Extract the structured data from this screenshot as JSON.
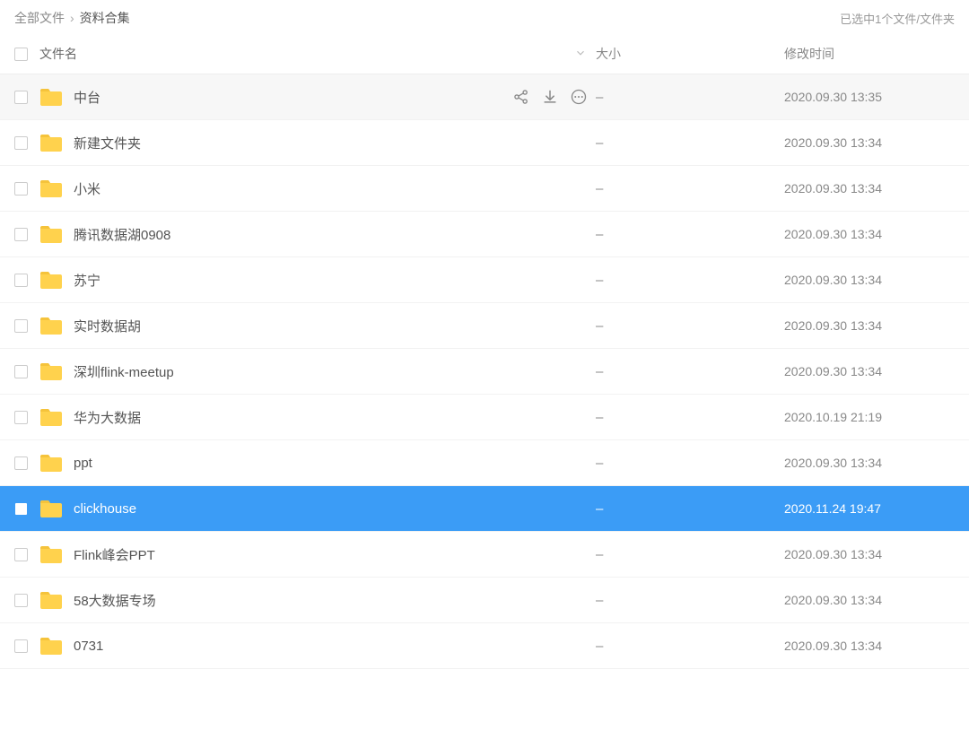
{
  "breadcrumb": {
    "root": "全部文件",
    "current": "资料合集"
  },
  "selection_status": "已选中1个文件/文件夹",
  "columns": {
    "name": "文件名",
    "size": "大小",
    "time": "修改时间"
  },
  "size_placeholder": "–",
  "files": [
    {
      "name": "中台",
      "size": "–",
      "time": "2020.09.30 13:35",
      "selected": false,
      "hovered": true
    },
    {
      "name": "新建文件夹",
      "size": "–",
      "time": "2020.09.30 13:34",
      "selected": false,
      "hovered": false
    },
    {
      "name": "小米",
      "size": "–",
      "time": "2020.09.30 13:34",
      "selected": false,
      "hovered": false
    },
    {
      "name": "腾讯数据湖0908",
      "size": "–",
      "time": "2020.09.30 13:34",
      "selected": false,
      "hovered": false
    },
    {
      "name": "苏宁",
      "size": "–",
      "time": "2020.09.30 13:34",
      "selected": false,
      "hovered": false
    },
    {
      "name": "实时数据胡",
      "size": "–",
      "time": "2020.09.30 13:34",
      "selected": false,
      "hovered": false
    },
    {
      "name": "深圳flink-meetup",
      "size": "–",
      "time": "2020.09.30 13:34",
      "selected": false,
      "hovered": false
    },
    {
      "name": "华为大数据",
      "size": "–",
      "time": "2020.10.19 21:19",
      "selected": false,
      "hovered": false
    },
    {
      "name": "ppt",
      "size": "–",
      "time": "2020.09.30 13:34",
      "selected": false,
      "hovered": false
    },
    {
      "name": "clickhouse",
      "size": "–",
      "time": "2020.11.24 19:47",
      "selected": true,
      "hovered": false
    },
    {
      "name": "Flink峰会PPT",
      "size": "–",
      "time": "2020.09.30 13:34",
      "selected": false,
      "hovered": false
    },
    {
      "name": "58大数据专场",
      "size": "–",
      "time": "2020.09.30 13:34",
      "selected": false,
      "hovered": false
    },
    {
      "name": "0731",
      "size": "–",
      "time": "2020.09.30 13:34",
      "selected": false,
      "hovered": false
    }
  ]
}
